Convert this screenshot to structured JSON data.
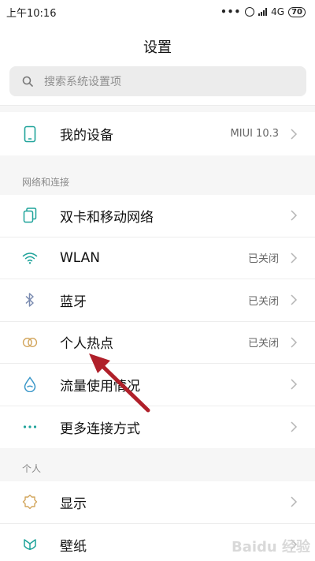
{
  "status_bar": {
    "time": "上午10:16",
    "more_dots": "•••",
    "network": "4G",
    "battery": "70"
  },
  "header": {
    "title": "设置",
    "search_placeholder": "搜索系统设置项"
  },
  "device": {
    "label": "我的设备",
    "value": "MIUI 10.3",
    "icon": "phone-icon"
  },
  "network_section": {
    "title": "网络和连接",
    "items": [
      {
        "label": "双卡和移动网络",
        "value": "",
        "icon": "sim-card-icon"
      },
      {
        "label": "WLAN",
        "value": "已关闭",
        "icon": "wifi-icon"
      },
      {
        "label": "蓝牙",
        "value": "已关闭",
        "icon": "bluetooth-icon"
      },
      {
        "label": "个人热点",
        "value": "已关闭",
        "icon": "hotspot-icon"
      },
      {
        "label": "流量使用情况",
        "value": "",
        "icon": "data-drop-icon"
      },
      {
        "label": "更多连接方式",
        "value": "",
        "icon": "more-dots-icon"
      }
    ]
  },
  "personal_section": {
    "title": "个人",
    "items": [
      {
        "label": "显示",
        "icon": "brightness-icon"
      },
      {
        "label": "壁纸",
        "icon": "wallpaper-icon"
      }
    ]
  },
  "watermark": "Baidu 经验",
  "colors": {
    "accent_teal": "#1fa39a",
    "arrow_red": "#b0202a",
    "background": "#f6f6f6"
  }
}
